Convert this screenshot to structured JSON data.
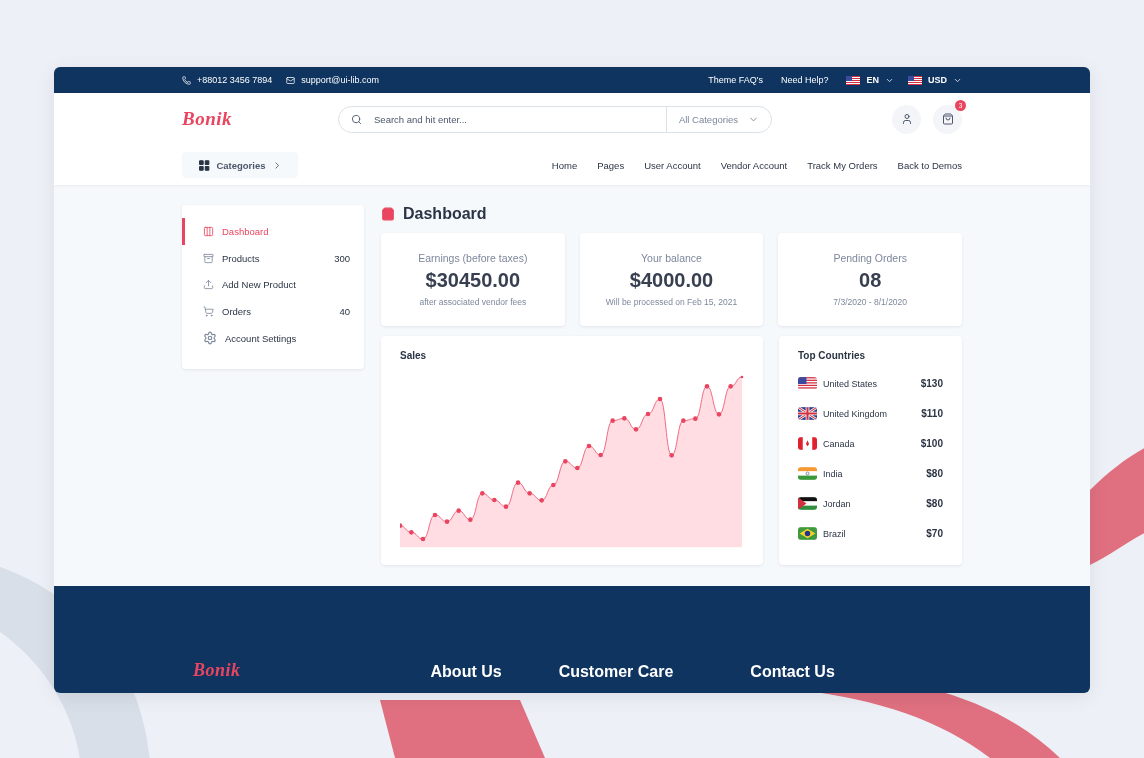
{
  "top_bar": {
    "phone": "+88012 3456 7894",
    "email": "support@ui-lib.com",
    "links": [
      "Theme FAQ's",
      "Need Help?"
    ],
    "language": "EN",
    "currency": "USD"
  },
  "header": {
    "logo": "Bonik",
    "search": {
      "placeholder": "Search and hit enter...",
      "category": "All Categories"
    },
    "cart_count": "3"
  },
  "nav": {
    "categories_button": "Categories",
    "links": [
      "Home",
      "Pages",
      "User Account",
      "Vendor Account",
      "Track My Orders",
      "Back to Demos"
    ]
  },
  "sidebar": {
    "items": [
      {
        "kind": "dashboard",
        "label": "Dashboard",
        "selected": true
      },
      {
        "kind": "products",
        "label": "Products",
        "count": "300",
        "selected": false
      },
      {
        "kind": "upload",
        "label": "Add New Product",
        "selected": false
      },
      {
        "kind": "orders",
        "label": "Orders",
        "count": "40",
        "selected": false
      },
      {
        "kind": "settings",
        "label": "Account Settings",
        "selected": false
      }
    ]
  },
  "page_title": "Dashboard",
  "stats": [
    {
      "title": "Earnings (before taxes)",
      "value": "$30450.00",
      "note": "after associated vendor fees"
    },
    {
      "title": "Your balance",
      "value": "$4000.00",
      "note": "Will be processed on Feb 15, 2021"
    },
    {
      "title": "Pending Orders",
      "value": "08",
      "note": "7/3/2020 - 8/1/2020"
    }
  ],
  "sales": {
    "title": "Sales"
  },
  "top_countries": {
    "title": "Top Countries",
    "rows": [
      {
        "name": "United States",
        "amount": "$130"
      },
      {
        "name": "United Kingdom",
        "amount": "$110"
      },
      {
        "name": "Canada",
        "amount": "$100"
      },
      {
        "name": "India",
        "amount": "$80"
      },
      {
        "name": "Jordan",
        "amount": "$80"
      },
      {
        "name": "Brazil",
        "amount": "$70"
      }
    ]
  },
  "footer": {
    "logo": "Bonik",
    "headings": [
      "About Us",
      "Customer Care",
      "Contact Us"
    ]
  }
}
